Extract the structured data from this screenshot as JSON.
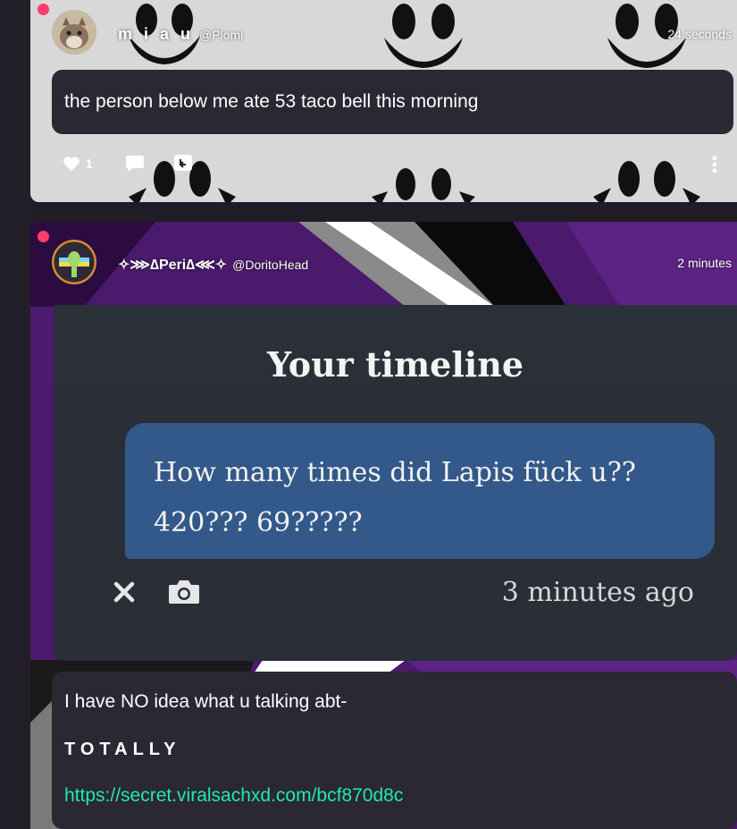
{
  "posts": [
    {
      "display_name": "m i a u",
      "handle": "@Plomi",
      "time": "24 seconds",
      "text": "the person below me ate 53 taco bell this morning",
      "like_count": "1",
      "icons": [
        "heart-icon",
        "comment-icon",
        "reply-icon",
        "more-icon"
      ]
    },
    {
      "display_name": "✧⋙∆Peri∆⋘✧",
      "handle": "@DoritoHead",
      "time": "2 minutes",
      "screenshot": {
        "title": "Your timeline",
        "message_line1": "How many times did Lapis fück u??",
        "message_line2": "420??? 69?????",
        "time": "3 minutes ago",
        "icons": [
          "close-icon",
          "camera-icon"
        ]
      },
      "text_line1": "I have NO idea what u talking abt-",
      "text_line2": "TOTALLY",
      "link": "https://secret.viralsachxd.com/bcf870d8c"
    }
  ],
  "colors": {
    "bubble": "#2b2733",
    "online_dot": "#ff3d6e",
    "link": "#1de9b6",
    "card": "#33598a"
  }
}
